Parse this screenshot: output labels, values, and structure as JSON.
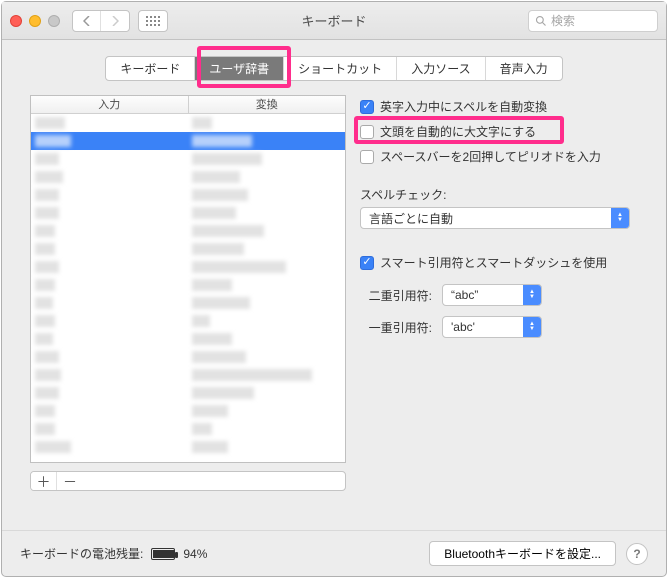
{
  "window": {
    "title": "キーボード",
    "search_placeholder": "検索"
  },
  "tabs": [
    {
      "label": "キーボード"
    },
    {
      "label": "ユーザ辞書",
      "active": true
    },
    {
      "label": "ショートカット"
    },
    {
      "label": "入力ソース"
    },
    {
      "label": "音声入力"
    }
  ],
  "table": {
    "columns": [
      "入力",
      "変換"
    ]
  },
  "checks": {
    "auto_spell_convert": {
      "label": "英字入力中にスペルを自動変換",
      "checked": true
    },
    "auto_capitalize": {
      "label": "文頭を自動的に大文字にする",
      "checked": false,
      "highlighted": true
    },
    "double_space_period": {
      "label": "スペースバーを2回押してピリオドを入力",
      "checked": false
    }
  },
  "spellcheck": {
    "label": "スペルチェック:",
    "value": "言語ごとに自動"
  },
  "smart_quotes": {
    "checkbox_label": "スマート引用符とスマートダッシュを使用",
    "checked": true,
    "double_label": "二重引用符:",
    "double_value": "“abc”",
    "single_label": "一重引用符:",
    "single_value": "'abc'"
  },
  "footer": {
    "battery_label": "キーボードの電池残量:",
    "battery_percent": "94%",
    "bluetooth_btn": "Bluetoothキーボードを設定...",
    "help": "?"
  },
  "buttons": {
    "add": "＋",
    "remove": "－"
  }
}
